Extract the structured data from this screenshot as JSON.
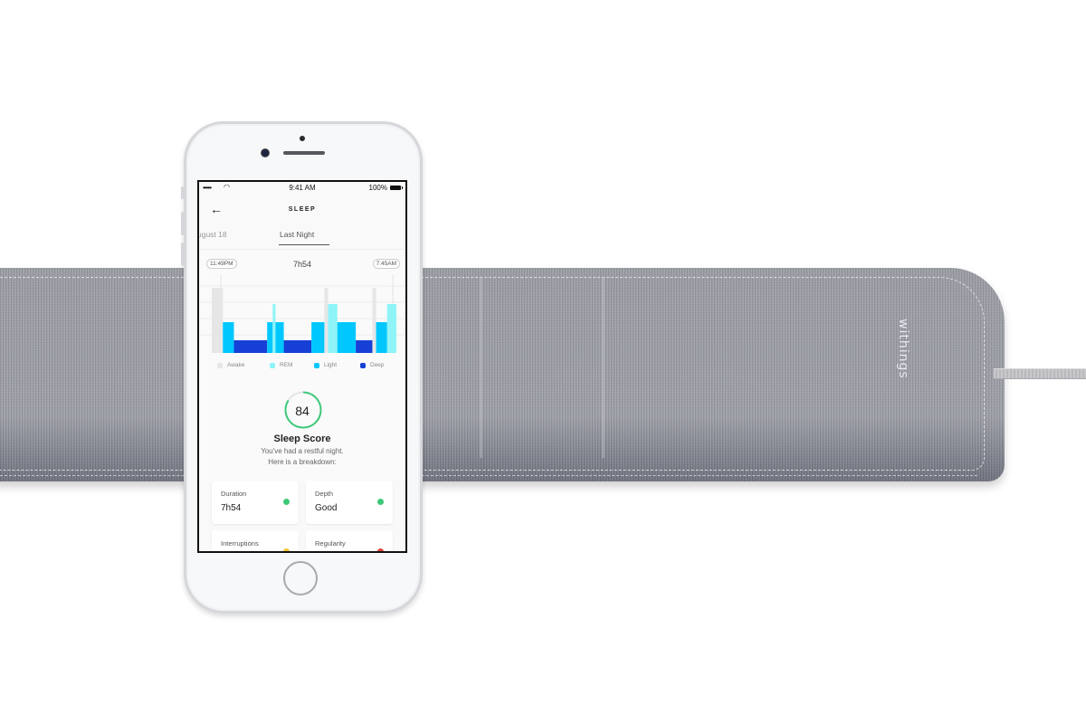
{
  "product": {
    "mat_brand": "withings"
  },
  "phone": {
    "status_bar": {
      "signal": "•••••",
      "wifi_icon": "wifi-icon",
      "time": "9:41 AM",
      "battery": "100%"
    },
    "nav": {
      "back_icon": "←",
      "title": "SLEEP"
    },
    "tabs": {
      "previous": "ugust 18",
      "active": "Last Night"
    },
    "chart": {
      "start_time": "11:49PM",
      "end_time": "7:45AM",
      "duration": "7h54"
    },
    "score": {
      "value": "84",
      "title": "Sleep Score",
      "description_line1": "You've had a restful night.",
      "description_line2": "Here is a breakdown:"
    },
    "breakdown": [
      {
        "label": "Duration",
        "value": "7h54",
        "status_color": "#3ec97a"
      },
      {
        "label": "Depth",
        "value": "Good",
        "status_color": "#3ec97a"
      },
      {
        "label": "Interruptions",
        "value": "",
        "status_color": "#f1c232"
      },
      {
        "label": "Regularity",
        "value": "",
        "status_color": "#e0443a"
      }
    ]
  },
  "chart_data": {
    "type": "bar",
    "title": "7h54",
    "x_range": [
      "11:49PM",
      "7:45AM"
    ],
    "y_levels": [
      "Deep",
      "Light",
      "REM",
      "Awake"
    ],
    "legend": [
      {
        "name": "Awake",
        "color": "#e6e6e6"
      },
      {
        "name": "REM",
        "color": "#8ef4f8"
      },
      {
        "name": "Light",
        "color": "#00c8ff"
      },
      {
        "name": "Deep",
        "color": "#1640d6"
      }
    ],
    "segments": [
      {
        "stage": "Awake",
        "start": 0.0,
        "end": 0.06
      },
      {
        "stage": "Light",
        "start": 0.06,
        "end": 0.12
      },
      {
        "stage": "Deep",
        "start": 0.12,
        "end": 0.3
      },
      {
        "stage": "Light",
        "start": 0.3,
        "end": 0.33
      },
      {
        "stage": "REM",
        "start": 0.33,
        "end": 0.345
      },
      {
        "stage": "Light",
        "start": 0.345,
        "end": 0.39
      },
      {
        "stage": "Deep",
        "start": 0.39,
        "end": 0.54
      },
      {
        "stage": "Light",
        "start": 0.54,
        "end": 0.61
      },
      {
        "stage": "Awake",
        "start": 0.61,
        "end": 0.63
      },
      {
        "stage": "REM",
        "start": 0.63,
        "end": 0.68
      },
      {
        "stage": "Light",
        "start": 0.68,
        "end": 0.78
      },
      {
        "stage": "Deep",
        "start": 0.78,
        "end": 0.87
      },
      {
        "stage": "Awake",
        "start": 0.87,
        "end": 0.89
      },
      {
        "stage": "Light",
        "start": 0.89,
        "end": 0.95
      },
      {
        "stage": "REM",
        "start": 0.95,
        "end": 1.0
      }
    ]
  }
}
